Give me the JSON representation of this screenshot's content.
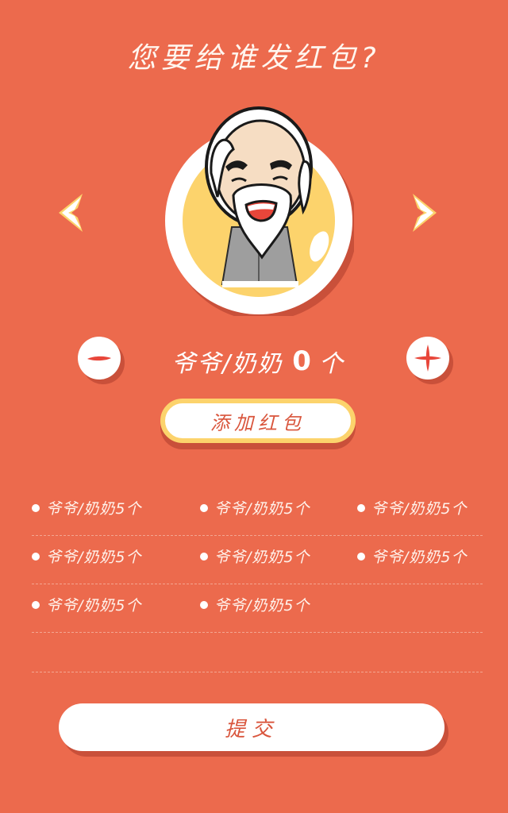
{
  "header": {
    "title": "您要给谁发红包?"
  },
  "selector": {
    "prev_icon": "chevron-left-icon",
    "next_icon": "chevron-right-icon",
    "avatar": "grandpa-avatar"
  },
  "stepper": {
    "label_prefix": "爷爷/奶奶",
    "value": "0",
    "unit": "个",
    "minus_icon": "minus-icon",
    "plus_icon": "plus-icon"
  },
  "add_button": {
    "label": "添加红包"
  },
  "list": {
    "rows": [
      [
        "爷爷/奶奶5个",
        "爷爷/奶奶5个",
        "爷爷/奶奶5个"
      ],
      [
        "爷爷/奶奶5个",
        "爷爷/奶奶5个",
        "爷爷/奶奶5个"
      ],
      [
        "爷爷/奶奶5个",
        "爷爷/奶奶5个"
      ]
    ]
  },
  "submit_button": {
    "label": "提交"
  },
  "colors": {
    "background": "#ec6a4d",
    "accent_yellow": "#fcd36c",
    "button_text": "#d9553c",
    "shadow": "#c9503a"
  }
}
